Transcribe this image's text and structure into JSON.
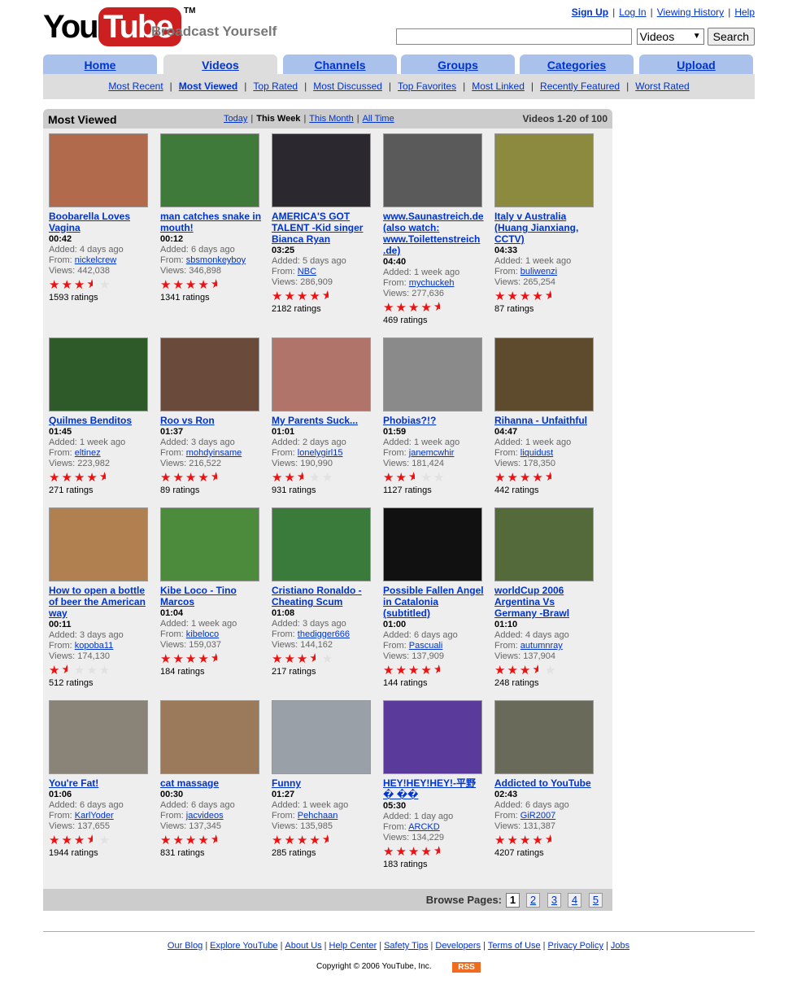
{
  "logo": {
    "you": "You",
    "tube": "Tube",
    "tm": "TM",
    "tagline": "Broadcast Yourself"
  },
  "toplinks": [
    "Sign Up",
    "Log In",
    "Viewing History",
    "Help"
  ],
  "search": {
    "value": "",
    "select": "Videos",
    "button": "Search"
  },
  "tabs": [
    "Home",
    "Videos",
    "Channels",
    "Groups",
    "Categories",
    "Upload"
  ],
  "active_tab": "Videos",
  "subnav": [
    "Most Recent",
    "Most Viewed",
    "Top Rated",
    "Most Discussed",
    "Top Favorites",
    "Most Linked",
    "Recently Featured",
    "Worst Rated"
  ],
  "box": {
    "title": "Most Viewed",
    "periods": [
      "Today",
      "This Week",
      "This Month",
      "All Time"
    ],
    "count": "Videos 1-20 of 100"
  },
  "labels": {
    "added": "Added:",
    "from": "From:",
    "views": "Views:",
    "ratings_suffix": "ratings"
  },
  "videos": [
    {
      "title": "Boobarella Loves Vagina",
      "duration": "00:42",
      "added": "4 days ago",
      "from": "nickelcrew",
      "views": "442,038",
      "stars": 3.5,
      "ratings": "1593",
      "thumb": "#b26a4d"
    },
    {
      "title": "man catches snake in mouth!",
      "duration": "00:12",
      "added": "6 days ago",
      "from": "sbsmonkeyboy",
      "views": "346,898",
      "stars": 4.5,
      "ratings": "1341",
      "thumb": "#3f7a3a"
    },
    {
      "title": "AMERICA'S GOT TALENT -Kid singer Bianca Ryan",
      "duration": "03:25",
      "added": "5 days ago",
      "from": "NBC",
      "views": "286,909",
      "stars": 4.5,
      "ratings": "2182",
      "thumb": "#2b2830"
    },
    {
      "title": "www.Saunastreich.de (also watch: www.Toilettenstreich .de)",
      "duration": "04:40",
      "added": "1 week ago",
      "from": "mychuckeh",
      "views": "277,636",
      "stars": 4.5,
      "ratings": "469",
      "thumb": "#5a5a5a"
    },
    {
      "title": "Italy v Australia (Huang Jianxiang, CCTV)",
      "duration": "04:33",
      "added": "1 week ago",
      "from": "buliwenzi",
      "views": "265,254",
      "stars": 4.5,
      "ratings": "87",
      "thumb": "#8c8a3e"
    },
    {
      "title": "Quilmes Benditos",
      "duration": "01:45",
      "added": "1 week ago",
      "from": "eltinez",
      "views": "223,982",
      "stars": 4.5,
      "ratings": "271",
      "thumb": "#2e5a2a"
    },
    {
      "title": "Roo vs Ron",
      "duration": "01:37",
      "added": "3 days ago",
      "from": "mohdyinsame",
      "views": "216,522",
      "stars": 4.5,
      "ratings": "89",
      "thumb": "#6a4a3a"
    },
    {
      "title": "My Parents Suck...",
      "duration": "01:01",
      "added": "2 days ago",
      "from": "lonelygirl15",
      "views": "190,990",
      "stars": 2.5,
      "ratings": "931",
      "thumb": "#b0746a"
    },
    {
      "title": "Phobias?!?",
      "duration": "01:59",
      "added": "1 week ago",
      "from": "janemcwhir",
      "views": "181,424",
      "stars": 2.5,
      "ratings": "1127",
      "thumb": "#8a8a8a"
    },
    {
      "title": "Rihanna - Unfaithful",
      "duration": "04:47",
      "added": "1 week ago",
      "from": "liquidust",
      "views": "178,350",
      "stars": 4.5,
      "ratings": "442",
      "thumb": "#5e4a2c"
    },
    {
      "title": "How to open a bottle of beer the American way",
      "duration": "00:11",
      "added": "3 days ago",
      "from": "kopoba11",
      "views": "174,130",
      "stars": 1.5,
      "ratings": "512",
      "thumb": "#b08050"
    },
    {
      "title": "Kibe Loco - Tino Marcos",
      "duration": "01:04",
      "added": "1 week ago",
      "from": "kibeloco",
      "views": "159,037",
      "stars": 4.5,
      "ratings": "184",
      "thumb": "#4c8a3c"
    },
    {
      "title": "Cristiano Ronaldo - Cheating Scum",
      "duration": "01:08",
      "added": "3 days ago",
      "from": "thedigger666",
      "views": "144,162",
      "stars": 3.5,
      "ratings": "217",
      "thumb": "#3a7a3a"
    },
    {
      "title": "Possible Fallen Angel in Catalonia (subtitled)",
      "duration": "01:00",
      "added": "6 days ago",
      "from": "Pascuali",
      "views": "137,909",
      "stars": 4.5,
      "ratings": "144",
      "thumb": "#111111"
    },
    {
      "title": "worldCup 2006 Argentina Vs Germany -Brawl",
      "duration": "01:10",
      "added": "4 days ago",
      "from": "autumnray",
      "views": "137,904",
      "stars": 3.5,
      "ratings": "248",
      "thumb": "#556a3a"
    },
    {
      "title": "You're Fat!",
      "duration": "01:06",
      "added": "6 days ago",
      "from": "KarlYoder",
      "views": "137,655",
      "stars": 3.5,
      "ratings": "1944",
      "thumb": "#8a8478"
    },
    {
      "title": "cat massage",
      "duration": "00:30",
      "added": "6 days ago",
      "from": "jacvideos",
      "views": "137,345",
      "stars": 4.5,
      "ratings": "831",
      "thumb": "#9a7a5a"
    },
    {
      "title": "Funny",
      "duration": "01:27",
      "added": "1 week ago",
      "from": "Pehchaan",
      "views": "135,985",
      "stars": 4.5,
      "ratings": "285",
      "thumb": "#9aa0a8"
    },
    {
      "title": "HEY!HEY!HEY!-平野 � ��",
      "duration": "05:30",
      "added": "1 day ago",
      "from": "ARCKD",
      "views": "134,229",
      "stars": 4.5,
      "ratings": "183",
      "thumb": "#5a3a9a"
    },
    {
      "title": "Addicted to YouTube",
      "duration": "02:43",
      "added": "6 days ago",
      "from": "GiR2007",
      "views": "131,387",
      "stars": 4.5,
      "ratings": "4207",
      "thumb": "#6a6a5a"
    }
  ],
  "browse": {
    "label": "Browse Pages:",
    "pages": [
      "1",
      "2",
      "3",
      "4",
      "5"
    ],
    "current": "1"
  },
  "footer": {
    "links": [
      "Our Blog",
      "Explore YouTube",
      "About Us",
      "Help Center",
      "Safety Tips",
      "Developers",
      "Terms of Use",
      "Privacy Policy",
      "Jobs"
    ],
    "copyright": "Copyright © 2006 YouTube, Inc.",
    "rss": "RSS"
  }
}
